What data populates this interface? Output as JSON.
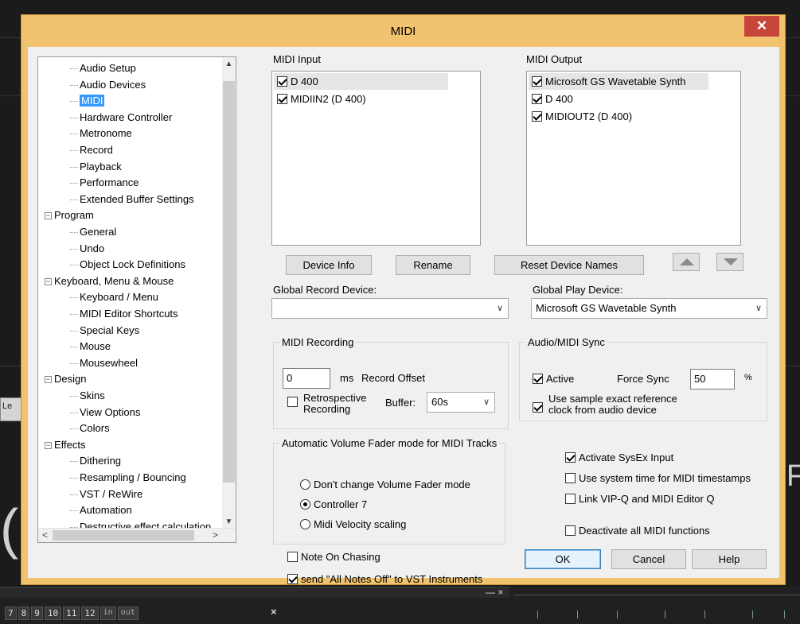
{
  "background": {
    "left_button_label": "Le",
    "big_char_left": "(",
    "big_char_right": "F",
    "window_controls": "— ×",
    "track_numbers": [
      "7",
      "8",
      "9",
      "10",
      "11",
      "12"
    ],
    "track_io": [
      "in",
      "out"
    ],
    "close_x": "×"
  },
  "dialog": {
    "title": "MIDI",
    "close_glyph": "✕"
  },
  "tree": {
    "items": [
      {
        "label": "Audio Setup",
        "level": 1
      },
      {
        "label": "Audio Devices",
        "level": 1
      },
      {
        "label": "MIDI",
        "level": 1,
        "selected": true
      },
      {
        "label": "Hardware Controller",
        "level": 1
      },
      {
        "label": "Metronome",
        "level": 1
      },
      {
        "label": "Record",
        "level": 1
      },
      {
        "label": "Playback",
        "level": 1
      },
      {
        "label": "Performance",
        "level": 1
      },
      {
        "label": "Extended Buffer Settings",
        "level": 1
      },
      {
        "label": "Program",
        "level": 0
      },
      {
        "label": "General",
        "level": 1
      },
      {
        "label": "Undo",
        "level": 1
      },
      {
        "label": "Object Lock Definitions",
        "level": 1
      },
      {
        "label": "Keyboard, Menu & Mouse",
        "level": 0
      },
      {
        "label": "Keyboard / Menu",
        "level": 1
      },
      {
        "label": "MIDI Editor Shortcuts",
        "level": 1
      },
      {
        "label": "Special Keys",
        "level": 1
      },
      {
        "label": "Mouse",
        "level": 1
      },
      {
        "label": "Mousewheel",
        "level": 1
      },
      {
        "label": "Design",
        "level": 0
      },
      {
        "label": "Skins",
        "level": 1
      },
      {
        "label": "View Options",
        "level": 1
      },
      {
        "label": "Colors",
        "level": 1
      },
      {
        "label": "Effects",
        "level": 0
      },
      {
        "label": "Dithering",
        "level": 1
      },
      {
        "label": "Resampling / Bouncing",
        "level": 1
      },
      {
        "label": "VST / ReWire",
        "level": 1
      },
      {
        "label": "Automation",
        "level": 1
      },
      {
        "label": "Destructive effect calculation",
        "level": 1
      }
    ],
    "expander_glyph": "−",
    "scroll_up": "▲",
    "scroll_down": "▼",
    "scroll_left": "<",
    "scroll_right": ">"
  },
  "midi_input": {
    "label": "MIDI Input",
    "devices": [
      {
        "name": "D 400",
        "checked": true
      },
      {
        "name": "MIDIIN2 (D 400)",
        "checked": true
      }
    ]
  },
  "midi_output": {
    "label": "MIDI Output",
    "devices": [
      {
        "name": "Microsoft GS Wavetable Synth",
        "checked": true
      },
      {
        "name": "D 400",
        "checked": true
      },
      {
        "name": "MIDIOUT2 (D 400)",
        "checked": true
      }
    ]
  },
  "buttons": {
    "device_info": "Device Info",
    "rename": "Rename",
    "reset_names": "Reset Device Names",
    "ok": "OK",
    "cancel": "Cancel",
    "help": "Help"
  },
  "global_record": {
    "label": "Global Record Device:",
    "value": ""
  },
  "global_play": {
    "label": "Global Play Device:",
    "value": "Microsoft GS Wavetable Synth"
  },
  "midi_recording": {
    "title": "MIDI Recording",
    "offset_value": "0",
    "offset_unit": "ms",
    "offset_label": "Record Offset",
    "retrospective_label_1": "Retrospective",
    "retrospective_label_2": "Recording",
    "retrospective_checked": false,
    "buffer_label": "Buffer:",
    "buffer_value": "60s"
  },
  "sync": {
    "title": "Audio/MIDI Sync",
    "active_label": "Active",
    "active_checked": true,
    "force_label": "Force Sync",
    "force_value": "50",
    "force_unit": "%",
    "sample_label_1": "Use sample exact reference",
    "sample_label_2": "clock from audio device",
    "sample_checked": true
  },
  "fader": {
    "title": "Automatic Volume Fader mode for MIDI Tracks",
    "options": [
      {
        "label": "Don't change Volume Fader mode",
        "selected": false
      },
      {
        "label": "Controller 7",
        "selected": true
      },
      {
        "label": "Midi Velocity scaling",
        "selected": false
      }
    ]
  },
  "options": {
    "sysex": {
      "label": "Activate SysEx Input",
      "checked": true
    },
    "system_time": {
      "label": "Use system time for MIDI timestamps",
      "checked": false
    },
    "link_vipq": {
      "label": "Link VIP-Q and MIDI Editor Q",
      "checked": false
    },
    "deactivate": {
      "label": "Deactivate all MIDI functions",
      "checked": false
    },
    "note_chasing": {
      "label": "Note On Chasing",
      "checked": false
    },
    "all_notes_off": {
      "label": "send \"All Notes Off\" to VST Instruments",
      "checked": true
    }
  },
  "colors": {
    "title_bar": "#f1c36e",
    "close_button": "#c7463c",
    "selection": "#3399ff"
  }
}
